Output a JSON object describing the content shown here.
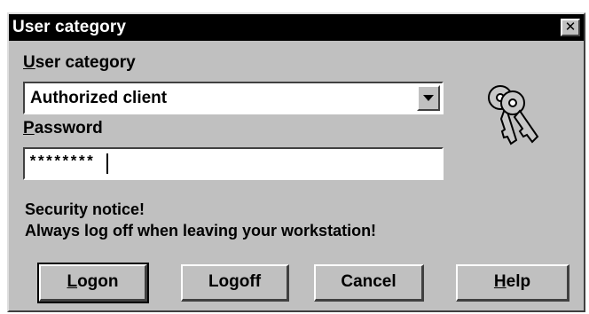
{
  "window": {
    "title": "User category"
  },
  "titlebar": {
    "close_icon": "close-icon"
  },
  "category": {
    "label_mnemonic": "U",
    "label_rest": "ser category",
    "selected": "Authorized client",
    "arrow_icon": "chevron-down-icon"
  },
  "password": {
    "label_mnemonic": "P",
    "label_rest": "assword",
    "value": "********"
  },
  "icon": {
    "name": "keys-icon"
  },
  "notice": {
    "line1": "Security notice!",
    "line2": "Always log off when leaving your workstation!"
  },
  "buttons": {
    "logon": {
      "mnemonic": "L",
      "rest": "ogon"
    },
    "logoff": {
      "pre": "Lo",
      "mnemonic": "g",
      "rest": "off"
    },
    "cancel": {
      "label": "Cancel"
    },
    "help": {
      "mnemonic": "H",
      "rest": "elp"
    }
  },
  "colors": {
    "dialog": "#c0c0c0",
    "titlebar": "#000000",
    "title_text": "#ffffff"
  }
}
